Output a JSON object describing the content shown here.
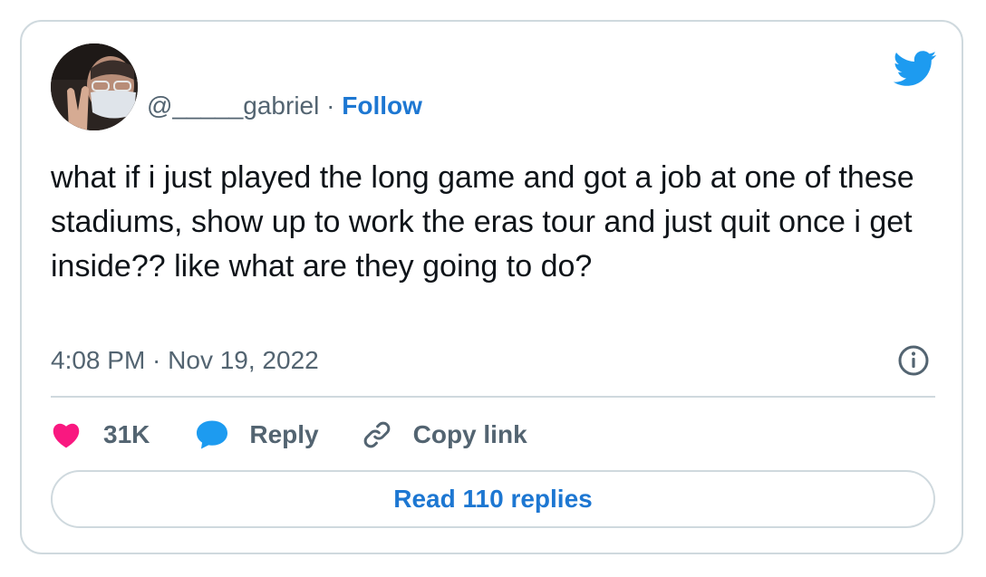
{
  "tweet": {
    "author": {
      "handle": "@_____gabriel",
      "avatar_icon": "user-avatar-photo"
    },
    "separator": "·",
    "follow_label": "Follow",
    "text": "what if i just played the long game and got a job at one of these stadiums, show up to work the eras tour and just quit once i get inside?? like what are they going to do?",
    "timestamp": "4:08 PM · Nov 19, 2022",
    "brand_icon": "twitter-bird-icon",
    "info_icon": "info-icon"
  },
  "actions": {
    "like_count": "31K",
    "like_icon": "heart-icon",
    "reply_label": "Reply",
    "reply_icon": "speech-bubble-icon",
    "copy_label": "Copy link",
    "copy_icon": "link-icon"
  },
  "read_replies_label": "Read 110 replies",
  "colors": {
    "brand_blue": "#1d9bf0",
    "link_blue": "#1d77d2",
    "heart_pink": "#f91880",
    "muted_text": "#536471",
    "border": "#cfd9de",
    "text": "#0f1419"
  }
}
